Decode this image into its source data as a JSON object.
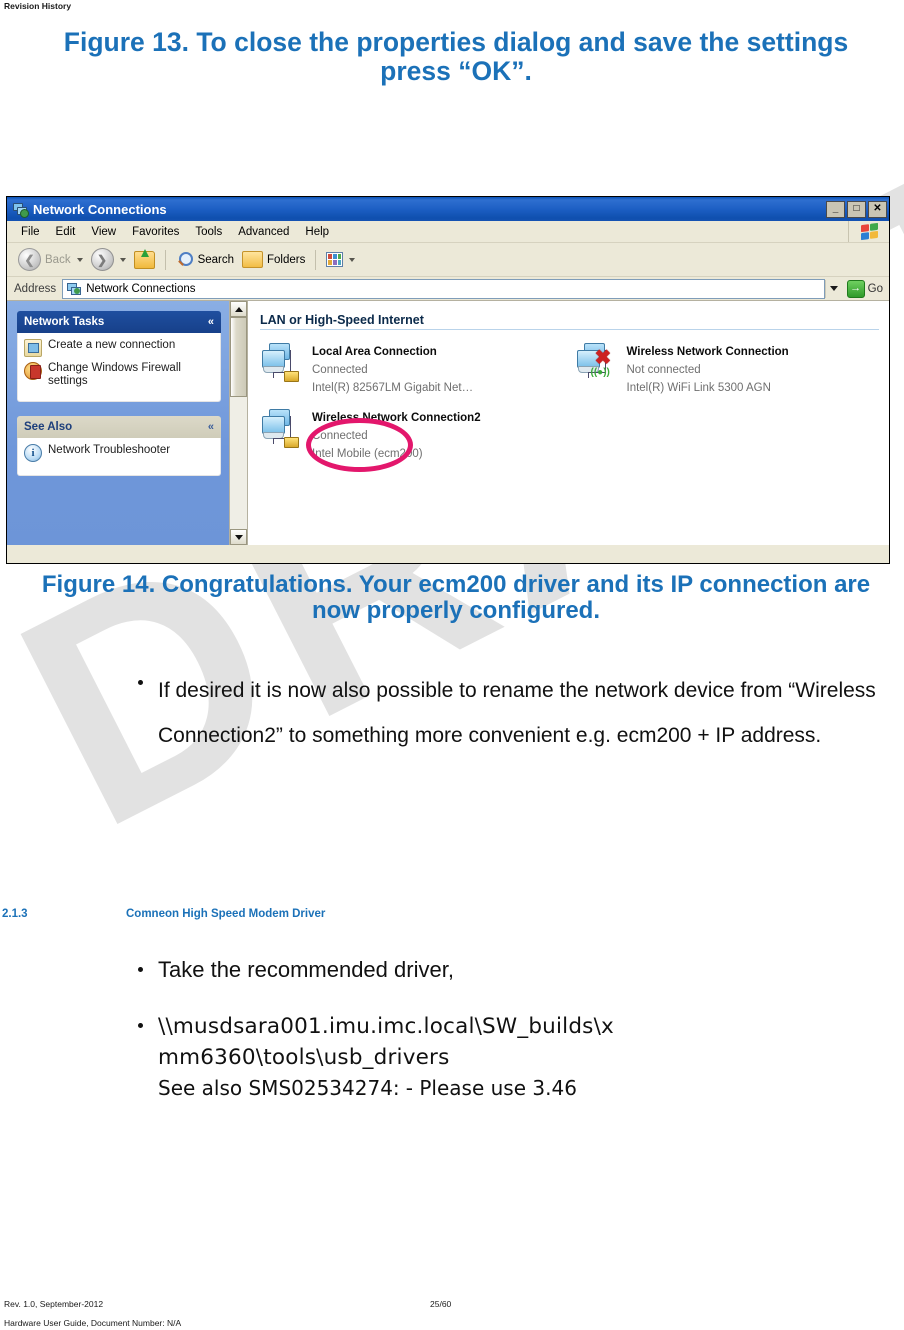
{
  "page": {
    "header_label": "Revision History",
    "accent_color": "#1b71b8",
    "watermark_text": "DRAFT"
  },
  "figure_13": {
    "caption": "Figure 13. To close the properties dialog and save the settings press “OK”."
  },
  "figure_14": {
    "caption": "Figure 14.  Congratulations. Your ecm200 driver and its IP connection are now properly configured."
  },
  "explorer_window": {
    "title": "Network Connections",
    "title_icon": "network-connections-icon",
    "window_buttons": {
      "minimize": "_",
      "maximize": "□",
      "close": "✕"
    },
    "menu_items": [
      "File",
      "Edit",
      "View",
      "Favorites",
      "Tools",
      "Advanced",
      "Help"
    ],
    "toolbar": {
      "back_label": "Back",
      "search_label": "Search",
      "folders_label": "Folders"
    },
    "address_bar": {
      "label": "Address",
      "value": "Network Connections",
      "go_label": "Go",
      "go_glyph": "→"
    },
    "sidebar": {
      "panels": [
        {
          "title": "Network Tasks",
          "collapse_glyph": "«",
          "items": [
            {
              "label": "Create a new connection",
              "icon": "new-connection-icon"
            },
            {
              "label": "Change Windows Firewall settings",
              "icon": "firewall-icon"
            }
          ]
        },
        {
          "title": "See Also",
          "collapse_glyph": "«",
          "items": [
            {
              "label": "Network Troubleshooter",
              "icon": "info-icon"
            }
          ]
        }
      ]
    },
    "content": {
      "group_title": "LAN or High-Speed Internet",
      "connections": [
        {
          "name": "Local Area Connection",
          "status": "Connected",
          "device": "Intel(R) 82567LM Gigabit Net…",
          "icon": "network-adapter-icon",
          "state": "connected"
        },
        {
          "name": "Wireless Network Connection",
          "status": "Not connected",
          "device": "Intel(R) WiFi Link 5300 AGN",
          "icon": "wireless-adapter-disconnected-icon",
          "state": "disconnected"
        },
        {
          "name": "Wireless Network Connection2",
          "status": "Connected",
          "device": "Intel Mobile (ecm200)",
          "icon": "network-adapter-icon",
          "state": "connected",
          "annotated": true
        }
      ],
      "annotation_color": "#e3176c"
    }
  },
  "body_text": {
    "rename_bullets": [
      "If desired it is now also possible to rename the network device from “Wireless Connection2” to something more convenient e.g. ecm200 + IP address."
    ],
    "driver_bullets": [
      "Take the recommended driver,"
    ],
    "driver_path_line1": "\\\\musdsara001.imu.imc.local\\SW_builds\\x",
    "driver_path_line2": "mm6360\\tools\\usb_drivers",
    "see_also_label": "See also SMS02534274:",
    "see_also_note": "- Please use 3.46"
  },
  "section_heading": {
    "number": "2.1.3",
    "title": "Comneon High Speed Modem Driver"
  },
  "footer": {
    "revision": "Rev. 1.0, September-2012",
    "page_number": "25/60",
    "document": "Hardware User Guide, Document Number: N/A"
  }
}
